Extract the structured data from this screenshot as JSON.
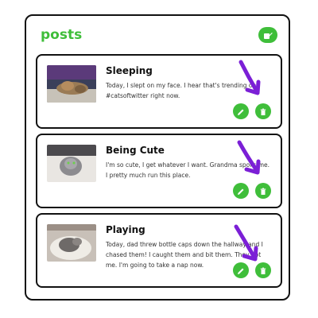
{
  "header": {
    "title": "posts"
  },
  "posts": [
    {
      "title": "Sleeping",
      "body": "Today, I slept on my face. I hear that's trending on #catsoftwitter right now."
    },
    {
      "title": "Being Cute",
      "body": "I'm so cute, I get whatever I want. Grandma spoils me. I pretty much run this place."
    },
    {
      "title": "Playing",
      "body": "Today, dad threw bottle caps down the hallway and I chased them! I caught them and bit them. They got me. I'm going to take a nap now."
    }
  ],
  "colors": {
    "accent": "#3fbe3a",
    "annotation": "#7b1fd6",
    "border": "#111111"
  },
  "icons": {
    "new_post": "compose-icon",
    "edit": "pencil-icon",
    "delete": "trash-icon"
  }
}
